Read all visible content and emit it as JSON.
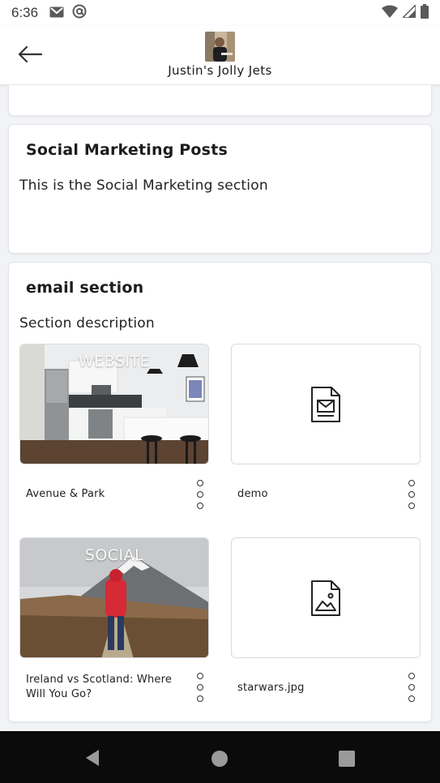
{
  "status_bar": {
    "time": "6:36",
    "left_icons": [
      "gmail-icon",
      "at-sign-icon"
    ],
    "right_icons": [
      "wifi-icon",
      "signal-icon",
      "battery-icon"
    ]
  },
  "header": {
    "title": "Justin's Jolly Jets",
    "back_icon": "arrow-left-icon"
  },
  "sections": {
    "social": {
      "heading": "Social Marketing Posts",
      "description": "This is the Social Marketing section"
    },
    "email": {
      "heading": "email section",
      "description": "Section description",
      "items": [
        {
          "name": "Avenue & Park",
          "overlay": "WEBSITE",
          "thumb": "kitchen-photo"
        },
        {
          "name": "demo",
          "overlay": "",
          "thumb": "email-doc-icon"
        },
        {
          "name": "Ireland vs Scotland: Where Will You Go?",
          "overlay": "SOCIAL",
          "thumb": "mountain-hiker-photo"
        },
        {
          "name": "starwars.jpg",
          "overlay": "",
          "thumb": "image-doc-icon"
        }
      ]
    }
  },
  "nav_bar": {
    "icons": [
      "nav-back-icon",
      "nav-home-icon",
      "nav-recents-icon"
    ]
  },
  "colors": {
    "background": "#f1f3f6",
    "card": "#ffffff",
    "text": "#1a1a1a",
    "nav": "#0b0b0b"
  }
}
